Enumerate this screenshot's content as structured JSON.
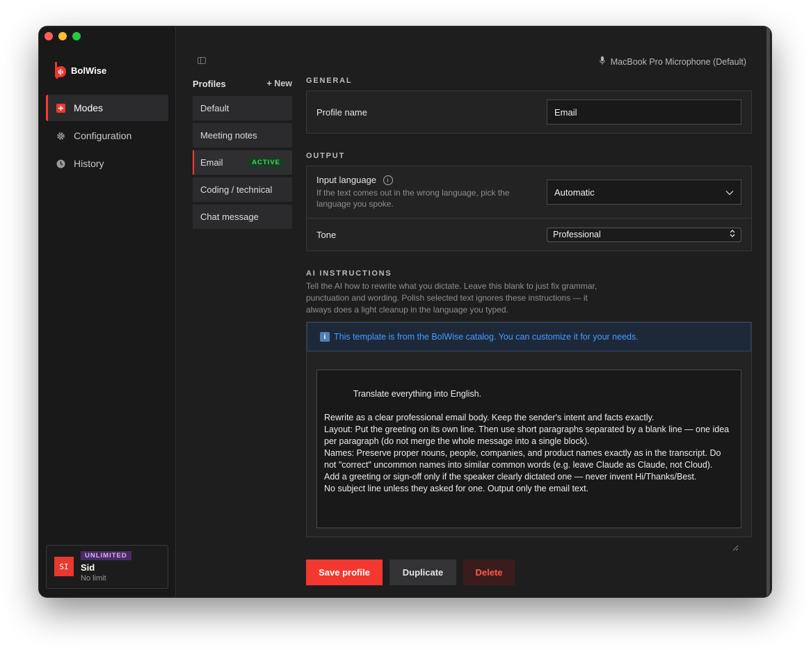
{
  "brand": {
    "name": "BolWise"
  },
  "nav": [
    {
      "label": "Modes",
      "icon": "plus-square-icon",
      "active": true
    },
    {
      "label": "Configuration",
      "icon": "gear-icon",
      "active": false
    },
    {
      "label": "History",
      "icon": "clock-icon",
      "active": false
    }
  ],
  "user": {
    "initials": "SI",
    "plan": "UNLIMITED",
    "name": "Sid",
    "limit": "No limit"
  },
  "header": {
    "microphone": "MacBook Pro Microphone (Default)"
  },
  "profiles": {
    "title": "Profiles",
    "new_label": "+ New",
    "items": [
      {
        "label": "Default"
      },
      {
        "label": "Meeting notes"
      },
      {
        "label": "Email",
        "badge": "ACTIVE"
      },
      {
        "label": "Coding / technical"
      },
      {
        "label": "Chat message"
      }
    ]
  },
  "general": {
    "section": "GENERAL",
    "profile_name_label": "Profile name",
    "profile_name_value": "Email"
  },
  "output": {
    "section": "OUTPUT",
    "input_language_label": "Input language",
    "input_language_hint": "If the text comes out in the wrong language, pick the language you spoke.",
    "input_language_value": "Automatic",
    "tone_label": "Tone",
    "tone_value": "Professional"
  },
  "ai": {
    "section": "AI INSTRUCTIONS",
    "description": "Tell the AI how to rewrite what you dictate. Leave this blank to just fix grammar, punctuation and wording. Polish selected text ignores these instructions — it always does a light cleanup in the language you typed.",
    "banner": "This template is from the BolWise catalog. You can customize it for your needs.",
    "instructions": "Translate everything into English.\n\nRewrite as a clear professional email body. Keep the sender's intent and facts exactly.\nLayout: Put the greeting on its own line. Then use short paragraphs separated by a blank line — one idea per paragraph (do not merge the whole message into a single block).\nNames: Preserve proper nouns, people, companies, and product names exactly as in the transcript. Do not \"correct\" uncommon names into similar common words (e.g. leave Claude as Claude, not Cloud).\nAdd a greeting or sign-off only if the speaker clearly dictated one — never invent Hi/Thanks/Best.\nNo subject line unless they asked for one. Output only the email text."
  },
  "actions": {
    "save": "Save profile",
    "duplicate": "Duplicate",
    "delete": "Delete"
  },
  "colors": {
    "accent": "#f2382f",
    "active_green": "#45d16a",
    "info_blue": "#4a9bff",
    "plan_purple": "#4a2a63"
  }
}
